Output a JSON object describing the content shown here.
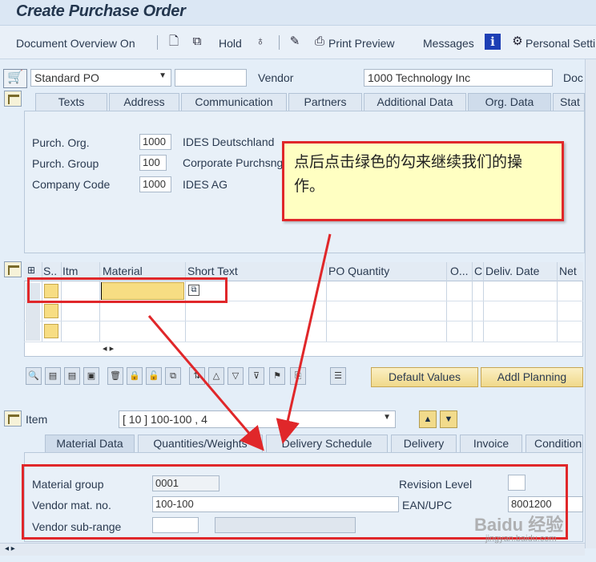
{
  "title": "Create Purchase Order",
  "toolbar": {
    "doc_overview": "Document Overview On",
    "hold": "Hold",
    "print_preview": "Print Preview",
    "messages": "Messages",
    "personal_settings": "Personal Setti"
  },
  "header": {
    "po_type": "Standard PO",
    "po_number": "",
    "vendor_label": "Vendor",
    "vendor_value": "1000 Technology Inc",
    "doc_date_label": "Doc"
  },
  "header_tabs": [
    "Texts",
    "Address",
    "Communication",
    "Partners",
    "Additional Data",
    "Org. Data",
    "Stat"
  ],
  "org_data": {
    "rows": [
      {
        "label": "Purch. Org.",
        "code": "1000",
        "desc": "IDES Deutschland"
      },
      {
        "label": "Purch. Group",
        "code": "100",
        "desc": "Corporate Purchsng"
      },
      {
        "label": "Company Code",
        "code": "1000",
        "desc": "IDES AG"
      }
    ]
  },
  "annotation": {
    "text": "点后点击绿色的勾来继续我们的操作。"
  },
  "items_table": {
    "columns": [
      "S..",
      "Itm",
      "Material",
      "Short Text",
      "PO Quantity",
      "O...",
      "C",
      "Deliv. Date",
      "Net"
    ],
    "scroll_arrows": "◂ ▸"
  },
  "item_buttons": {
    "default_values": "Default Values",
    "addl_planning": "Addl Planning"
  },
  "item_detail": {
    "label": "Item",
    "selector": "[ 10 ] 100-100 , 4"
  },
  "detail_tabs": [
    "Material Data",
    "Quantities/Weights",
    "Delivery Schedule",
    "Delivery",
    "Invoice",
    "Condition"
  ],
  "material_data": {
    "material_group_label": "Material group",
    "material_group": "0001",
    "vendor_mat_label": "Vendor mat. no.",
    "vendor_mat": "100-100",
    "vendor_subrange_label": "Vendor sub-range",
    "vendor_subrange": "",
    "revision_label": "Revision Level",
    "revision": "",
    "ean_label": "EAN/UPC",
    "ean": "8001200"
  },
  "watermark": {
    "logo": "Baidu 经验",
    "url": "jingyan.baidu.com"
  },
  "colors": {
    "highlight_border": "#e0272a",
    "note_bg": "#ffffc2",
    "material_cell": "#f7dd83"
  }
}
